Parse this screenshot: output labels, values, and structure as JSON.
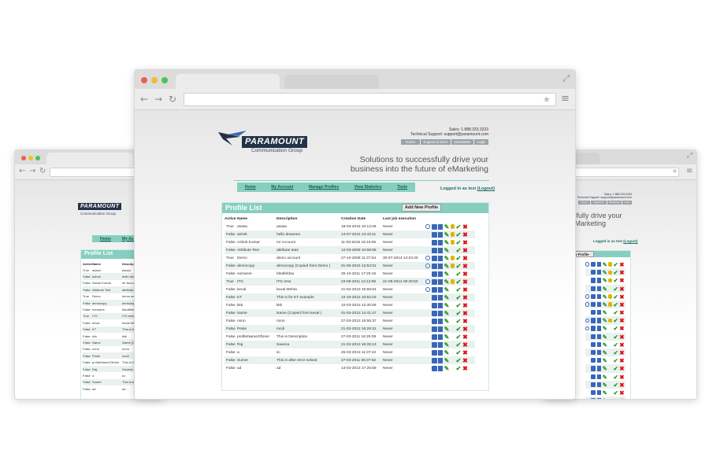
{
  "header": {
    "logo_name": "PARAMOUNT",
    "logo_sub": "Communication Group",
    "sales": "Sales: 1.888.333.3333",
    "support": "Technical Support: support@paramount.com",
    "top_links": [
      "Home",
      "Support & Docs",
      "Newsletter",
      "Login"
    ],
    "tagline_line1": "Solutions to successfully drive your",
    "tagline_line2": "business into the future of eMarketing"
  },
  "nav": {
    "items": [
      "Home",
      "My Account",
      "Manage Profiles",
      "View Statistics",
      "Tools"
    ],
    "logged_in": "Logged in as test",
    "logout": "(Logout)"
  },
  "panel": {
    "title": "Profile List",
    "add_button": "Add New Profile"
  },
  "table": {
    "columns": [
      "Active",
      "Name",
      "Description",
      "Creation Date",
      "Last job execution"
    ],
    "rows": [
      {
        "active": "True",
        "name": "asasa",
        "desc": "asasa",
        "date": "18-03-2015 10:13:26",
        "last": "Never",
        "view": true,
        "lock": true
      },
      {
        "active": "False",
        "name": "ashok",
        "desc": "hello deaeeee",
        "date": "14-07-2015 13:43:11",
        "last": "Never",
        "view": false,
        "lock": true
      },
      {
        "active": "False",
        "name": "Ashok Kumar",
        "desc": "mr Account",
        "date": "11-03-2015 18:19:05",
        "last": "Never",
        "view": false,
        "lock": true
      },
      {
        "active": "False",
        "name": "Attribute Test",
        "desc": "attribute teas",
        "date": "12-03-2009 10:58:58",
        "last": "Never",
        "view": false,
        "lock": false
      },
      {
        "active": "True",
        "name": "Demo",
        "desc": "demo account",
        "date": "27-10-2008 11:37:54",
        "last": "30-07-2014 14:23:40",
        "view": true,
        "lock": true
      },
      {
        "active": "False",
        "name": "democopy",
        "desc": "democopy (Copied from Demo )",
        "date": "01-06-2016 12:53:01",
        "last": "Never",
        "view": true,
        "lock": true
      },
      {
        "active": "False",
        "name": "eorrwere",
        "desc": "fdsdfefdsa",
        "date": "25-10-2011 17:26:15",
        "last": "Never",
        "view": false,
        "lock": false
      },
      {
        "active": "True",
        "name": "ITG",
        "desc": "ITG ems",
        "date": "23-06-2011 14:12:56",
        "last": "21-08-2014 09:30:50",
        "view": true,
        "lock": true
      },
      {
        "active": "False",
        "name": "keval",
        "desc": "keval Mehta",
        "date": "21-02-2013 16:58:54",
        "last": "Never",
        "view": true,
        "lock": false
      },
      {
        "active": "False",
        "name": "KT",
        "desc": "This is for KT example",
        "date": "12-10-2012 10:54:19",
        "last": "Never",
        "view": false,
        "lock": false
      },
      {
        "active": "False",
        "name": "kkk",
        "desc": "kkk",
        "date": "10-03-2013 12:30:08",
        "last": "Never",
        "view": false,
        "lock": false
      },
      {
        "active": "False",
        "name": "Name",
        "desc": "Name (Copied from keval )",
        "date": "01-03-2013 14:41:47",
        "last": "Never",
        "view": false,
        "lock": false
      },
      {
        "active": "False",
        "name": "nnnn",
        "desc": "nnnn",
        "date": "27-03-2013 15:55:37",
        "last": "Never",
        "view": false,
        "lock": false
      },
      {
        "active": "False",
        "name": "Pesie",
        "desc": "mcdi",
        "date": "21-02-2013 16:29:31",
        "last": "Never",
        "view": false,
        "lock": false
      },
      {
        "active": "False",
        "name": "profileNameOfUser",
        "desc": "This is Description",
        "date": "27-03-2011 16:25:09",
        "last": "Never",
        "view": false,
        "lock": false
      },
      {
        "active": "False",
        "name": "Raj",
        "desc": "Saxena",
        "date": "21-02-2013 16:26:13",
        "last": "Never",
        "view": false,
        "lock": false
      },
      {
        "active": "False",
        "name": "a",
        "desc": "sc",
        "date": "26-02-2013 11:37:42",
        "last": "Never",
        "view": false,
        "lock": false
      },
      {
        "active": "False",
        "name": "Sumer",
        "desc": "This is after error solved",
        "date": "27-03-2011 06:37:52",
        "last": "Never",
        "view": false,
        "lock": false
      },
      {
        "active": "False",
        "name": "ad",
        "desc": "ad",
        "date": "14-02-2013 17:25:59",
        "last": "Never",
        "view": false,
        "lock": false
      }
    ]
  },
  "side": {
    "left_nav": [
      "Home",
      "My Acc"
    ],
    "left_panel_title": "Profile List",
    "left_desc_header": "Descrip",
    "right_tagline1": "successfully drive your",
    "right_tagline2": "ure of eMarketing",
    "right_panel_title": "ew Profile",
    "right_logged_in": "Logged in as test",
    "right_logout": "(Logout)"
  },
  "colors": {
    "teal": "#86cfc0",
    "logo_navy": "#243247",
    "blue_icon": "#3a66b8",
    "green_icon": "#1f9e1f",
    "red_icon": "#d11111"
  },
  "icons": [
    "view-icon",
    "save-icon",
    "copy-icon",
    "edit-icon",
    "lock-icon",
    "check-icon",
    "delete-icon"
  ]
}
